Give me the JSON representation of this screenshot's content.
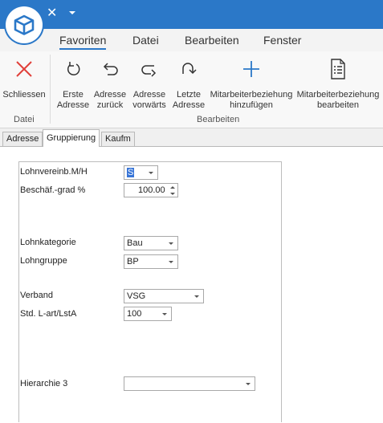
{
  "titlebar": {
    "close_glyph": "✕",
    "accent_color": "#2b78c8"
  },
  "menu": {
    "items": [
      "Favoriten",
      "Datei",
      "Bearbeiten",
      "Fenster"
    ],
    "active": "Favoriten"
  },
  "ribbon": {
    "buttons": [
      {
        "line1": "Schliessen",
        "line2": "",
        "icon": "close-x-icon"
      },
      {
        "line1": "Erste",
        "line2": "Adresse",
        "icon": "rotate-arrow-icon"
      },
      {
        "line1": "Adresse",
        "line2": "zurück",
        "icon": "back-arrow-icon"
      },
      {
        "line1": "Adresse",
        "line2": "vorwärts",
        "icon": "forward-arrow-icon"
      },
      {
        "line1": "Letzte",
        "line2": "Adresse",
        "icon": "last-arrow-icon"
      },
      {
        "line1": "Mitarbeiterbeziehung",
        "line2": "hinzufügen",
        "icon": "plus-icon"
      },
      {
        "line1": "Mitarbeiterbeziehung",
        "line2": "bearbeiten",
        "icon": "document-list-icon"
      }
    ],
    "groups": [
      "Datei",
      "Bearbeiten"
    ]
  },
  "tabs": [
    "Adresse",
    "Gruppierung",
    "Kaufm"
  ],
  "active_tab": "Gruppierung",
  "form": {
    "lohnvereinb_label": "Lohnvereinb.M/H",
    "lohnvereinb_value": "S",
    "beschaef_label": "Beschäf.-grad %",
    "beschaef_value": "100.00",
    "lohnkategorie_label": "Lohnkategorie",
    "lohnkategorie_value": "Bau",
    "lohngruppe_label": "Lohngruppe",
    "lohngruppe_value": "BP",
    "verband_label": "Verband",
    "verband_value": "VSG",
    "std_lart_label": "Std. L-art/LstA",
    "std_lart_value": "100",
    "hierarchie_label": "Hierarchie 3",
    "hierarchie_value": ""
  }
}
